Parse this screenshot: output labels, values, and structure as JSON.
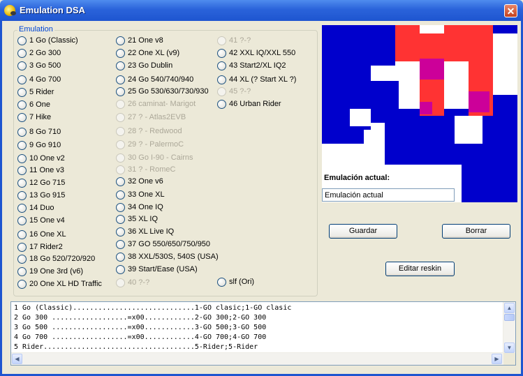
{
  "window": {
    "title": "Emulation DSA",
    "close_label": "✕"
  },
  "emulation": {
    "legend": "Emulation",
    "columns": [
      [
        {
          "label": "1 Go (Classic)",
          "enabled": true
        },
        {
          "label": "2 Go 300",
          "enabled": true
        },
        {
          "label": "3 Go 500",
          "enabled": true
        },
        {
          "label": "4 Go 700",
          "enabled": true
        },
        {
          "label": "5 Rider",
          "enabled": true
        },
        {
          "label": "6 One",
          "enabled": true
        },
        {
          "label": "7 Hike",
          "enabled": true
        },
        {
          "label": "8 Go 710",
          "enabled": true
        },
        {
          "label": "9 Go 910",
          "enabled": true
        },
        {
          "label": "10 One v2",
          "enabled": true
        },
        {
          "label": "11 One v3",
          "enabled": true
        },
        {
          "label": "12 Go 715",
          "enabled": true
        },
        {
          "label": "13 Go 915",
          "enabled": true
        },
        {
          "label": "14 Duo",
          "enabled": true
        },
        {
          "label": "15 One v4",
          "enabled": true
        },
        {
          "label": "16 One XL",
          "enabled": true
        },
        {
          "label": "17 Rider2",
          "enabled": true
        },
        {
          "label": "18 Go 520/720/920",
          "enabled": true
        },
        {
          "label": "19 One 3rd (v6)",
          "enabled": true
        },
        {
          "label": "20 One XL HD Traffic",
          "enabled": true
        }
      ],
      [
        {
          "label": "21 One v8",
          "enabled": true
        },
        {
          "label": "22 One XL (v9)",
          "enabled": true
        },
        {
          "label": "23 Go Dublin",
          "enabled": true
        },
        {
          "label": "24 Go 540/740/940",
          "enabled": true
        },
        {
          "label": "25 Go 530/630/730/930",
          "enabled": true
        },
        {
          "label": "26 caminat- Marigot",
          "enabled": false
        },
        {
          "label": "27 ? - Atlas2EVB",
          "enabled": false
        },
        {
          "label": "28 ? - Redwood",
          "enabled": false
        },
        {
          "label": "29 ? - PalermoC",
          "enabled": false
        },
        {
          "label": "30 Go I-90 - Cairns",
          "enabled": false
        },
        {
          "label": "31 ? - RomeC",
          "enabled": false
        },
        {
          "label": "32 One v6",
          "enabled": true
        },
        {
          "label": "33 One XL",
          "enabled": true
        },
        {
          "label": "34 One IQ",
          "enabled": true
        },
        {
          "label": "35 XL IQ",
          "enabled": true
        },
        {
          "label": "36 XL Live IQ",
          "enabled": true
        },
        {
          "label": "37 GO 550/650/750/950",
          "enabled": true
        },
        {
          "label": "38 XXL/530S, 540S (USA)",
          "enabled": true
        },
        {
          "label": "39 Start/Ease (USA)",
          "enabled": true
        },
        {
          "label": "40 ?-?",
          "enabled": false
        }
      ],
      [
        {
          "label": "41 ?-?",
          "enabled": false
        },
        {
          "label": "42 XXL IQ/XXL 550",
          "enabled": true
        },
        {
          "label": "43 Start2/XL IQ2",
          "enabled": true
        },
        {
          "label": "44 XL (? Start XL ?)",
          "enabled": true
        },
        {
          "label": "45 ?-?",
          "enabled": false
        },
        {
          "label": "46 Urban Rider",
          "enabled": true
        },
        {
          "label": "slf (Ori)",
          "enabled": true
        }
      ]
    ]
  },
  "preview": {
    "colors": {
      "blue": "#0000CC",
      "red": "#FF3333",
      "magenta": "#CC0099",
      "white": "#FFFFFF"
    }
  },
  "current": {
    "label": "Emulación actual:",
    "value": "Emulación actual"
  },
  "buttons": {
    "save": "Guardar",
    "delete": "Borrar",
    "edit_reskin": "Editar reskin"
  },
  "output": {
    "lines": [
      "1 Go (Classic).............................1-GO clasic;1-GO clasic",
      "2 Go 300 ..................=x00............2-GO 300;2-GO 300",
      "3 Go 500 ..................=x00............3-GO 500;3-GO 500",
      "4 Go 700 ..................=x00............4-GO 700;4-GO 700",
      "5 Rider....................................5-Rider;5-Rider"
    ]
  }
}
